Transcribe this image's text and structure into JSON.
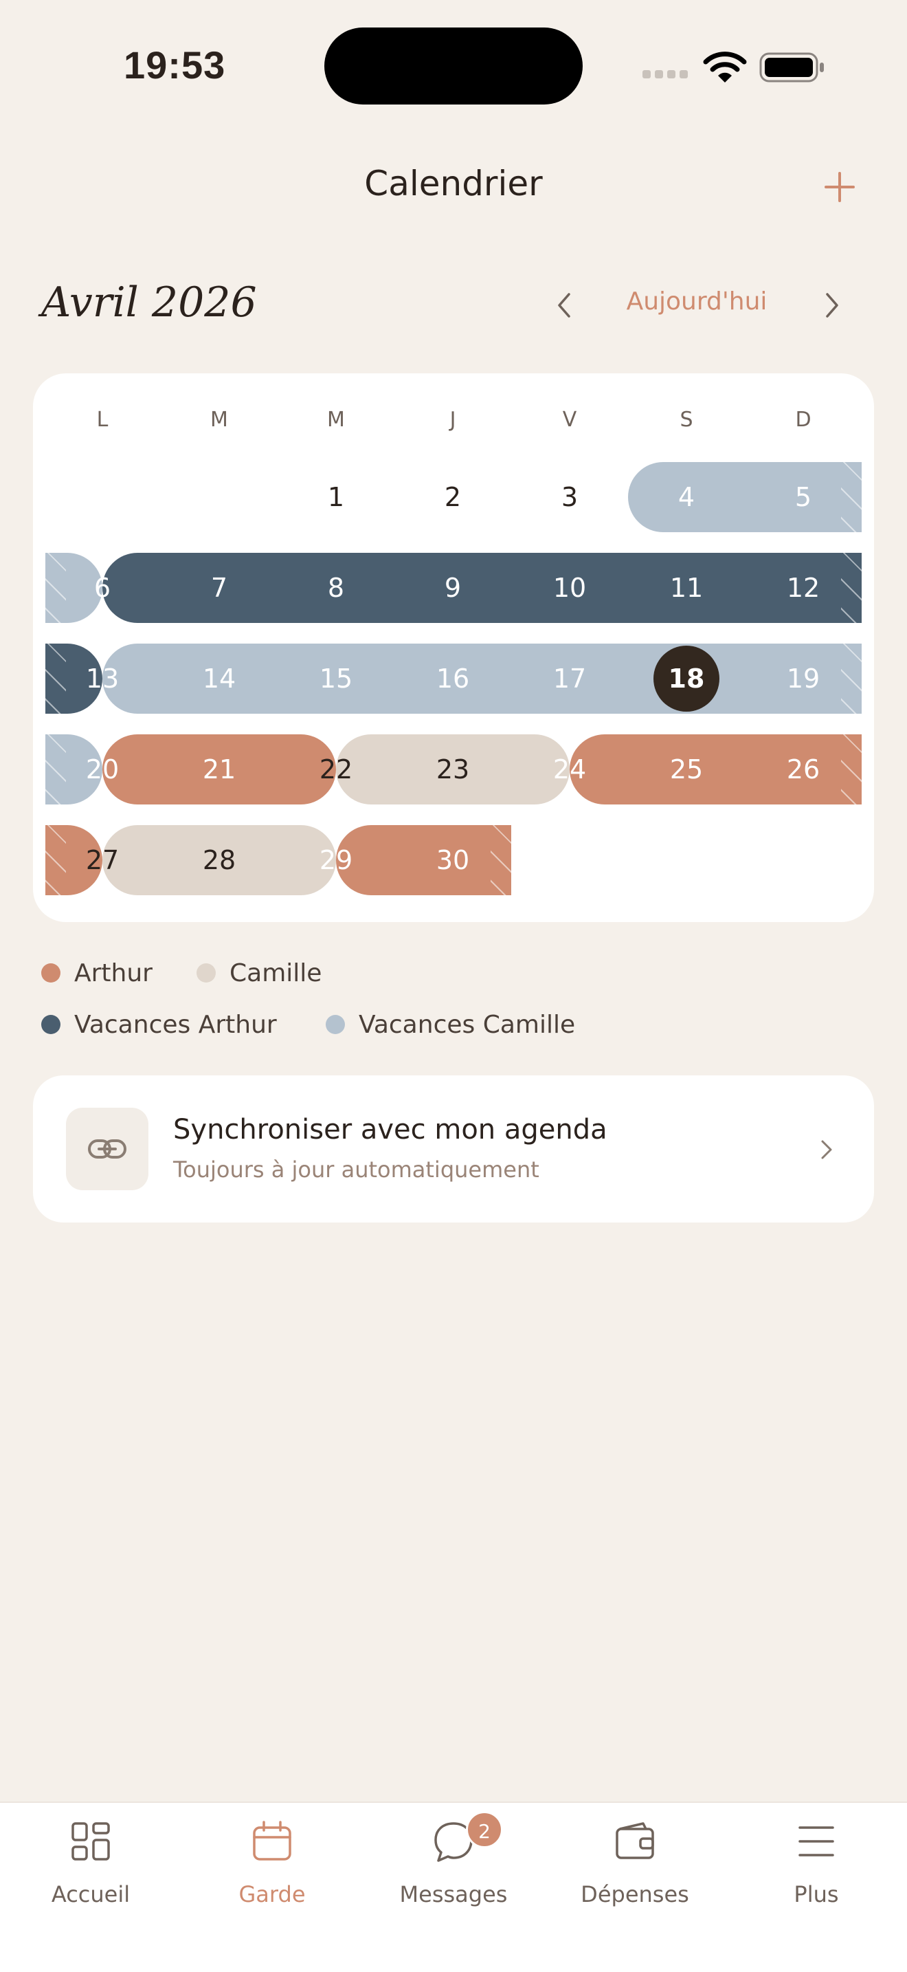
{
  "status_bar": {
    "time": "19:53"
  },
  "header": {
    "title": "Calendrier",
    "add_icon": "plus-icon"
  },
  "month_nav": {
    "month_label": "Avril 2026",
    "today_label": "Aujourd'hui"
  },
  "colors": {
    "arthur": "#cf8b6f",
    "camille": "#e0d6cc",
    "vacances_arthur": "#4a5e6f",
    "vacances_camille": "#b4c2cf",
    "today": "#33281f",
    "accent": "#cf8b6f"
  },
  "calendar": {
    "weekdays": [
      "L",
      "M",
      "M",
      "J",
      "V",
      "S",
      "D"
    ],
    "today": "18",
    "weeks": [
      [
        "",
        "",
        "1",
        "2",
        "3",
        "4",
        "5"
      ],
      [
        "6",
        "7",
        "8",
        "9",
        "10",
        "11",
        "12"
      ],
      [
        "13",
        "14",
        "15",
        "16",
        "17",
        "18",
        "19"
      ],
      [
        "20",
        "21",
        "22",
        "23",
        "24",
        "25",
        "26"
      ],
      [
        "27",
        "28",
        "29",
        "30",
        "",
        "",
        ""
      ]
    ]
  },
  "legend": [
    {
      "label": "Arthur",
      "color": "#cf8b6f"
    },
    {
      "label": "Camille",
      "color": "#e0d6cc"
    },
    {
      "label": "Vacances Arthur",
      "color": "#4a5e6f"
    },
    {
      "label": "Vacances Camille",
      "color": "#b4c2cf"
    }
  ],
  "sync": {
    "icon": "link-icon",
    "title": "Synchroniser avec mon agenda",
    "subtitle": "Toujours à jour automatiquement"
  },
  "tabbar": {
    "tabs": [
      {
        "label": "Accueil",
        "icon": "grid-icon"
      },
      {
        "label": "Garde",
        "icon": "calendar-icon",
        "active": true
      },
      {
        "label": "Messages",
        "icon": "chat-icon",
        "badge": "2"
      },
      {
        "label": "Dépenses",
        "icon": "wallet-icon"
      },
      {
        "label": "Plus",
        "icon": "menu-icon"
      }
    ]
  }
}
